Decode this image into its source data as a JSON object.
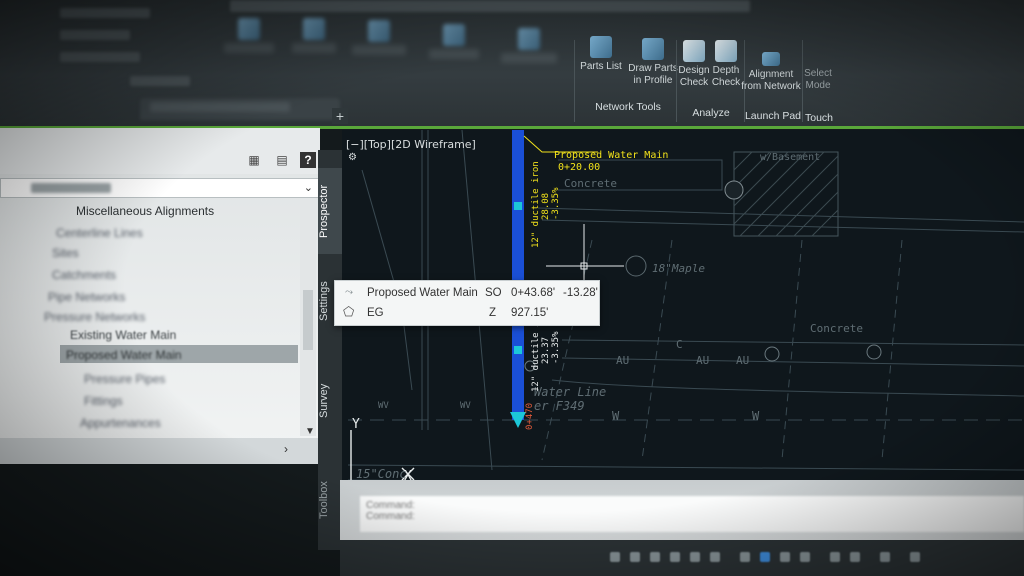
{
  "ribbon": {
    "buttons": {
      "parts_list": "Parts List",
      "draw_parts_in_profile": "Draw Parts in Profile",
      "design_check": "Design Check",
      "depth_check": "Depth Check",
      "alignment_from_network": "Alignment from Network",
      "select_mode": "Select Mode"
    },
    "panels": {
      "network_tools": "Network Tools",
      "analyze": "Analyze",
      "launch_pad": "Launch Pad",
      "touch": "Touch"
    },
    "accent_color": "#5aa83a"
  },
  "toolspace": {
    "tree": {
      "misc_alignments": "Miscellaneous Alignments",
      "existing_water_main": "Existing Water Main",
      "proposed_water_main": "Proposed Water Main",
      "pressure_pipes": "Pressure Pipes",
      "fittings": "Fittings",
      "appurtenances": "Appurtenances",
      "pipe_networks": "Pipe Networks",
      "pressure_networks": "Pressure Networks",
      "sites": "Sites",
      "catchments": "Catchments",
      "centerlines": "Centerline Lines"
    },
    "tabs": {
      "prospector": "Prospector",
      "settings": "Settings",
      "survey": "Survey",
      "toolbox": "Toolbox"
    }
  },
  "viewport": {
    "label": "[−][Top][2D Wireframe]",
    "annotations": {
      "proposed_water_main": "Proposed Water Main",
      "station": "0+20.00",
      "concrete_1": "Concrete",
      "concrete_2": "Concrete",
      "basement": "w/Basement",
      "maple": "18\"Maple",
      "water_line": "Water Line",
      "water_line_ref": "er F349",
      "pipe_label_1_a": "12\" ductile iron",
      "pipe_label_1_b": "28.08",
      "pipe_label_1_c": "-3.35%",
      "pipe_label_2_a": "12\" ductile ir",
      "pipe_label_2_b": "23.37",
      "pipe_label_2_c": "-3.35%",
      "end_station": "0+470",
      "wv_1": "WV",
      "wv_2": "WV",
      "conc": "15\"Conc",
      "au_1": "AU",
      "au_2": "AU",
      "au_3": "AU",
      "w_1": "W",
      "w_2": "W",
      "c_label": "C",
      "axis_y": "Y",
      "axis_x": "X"
    }
  },
  "tooltip": {
    "row1": {
      "name": "Proposed Water Main",
      "key": "SO",
      "station": "0+43.68'",
      "offset": "-13.28'"
    },
    "row2": {
      "name": "EG",
      "key": "Z",
      "value": "927.15'"
    }
  },
  "command": {
    "label_1": "Command:",
    "label_2": "Command:"
  }
}
